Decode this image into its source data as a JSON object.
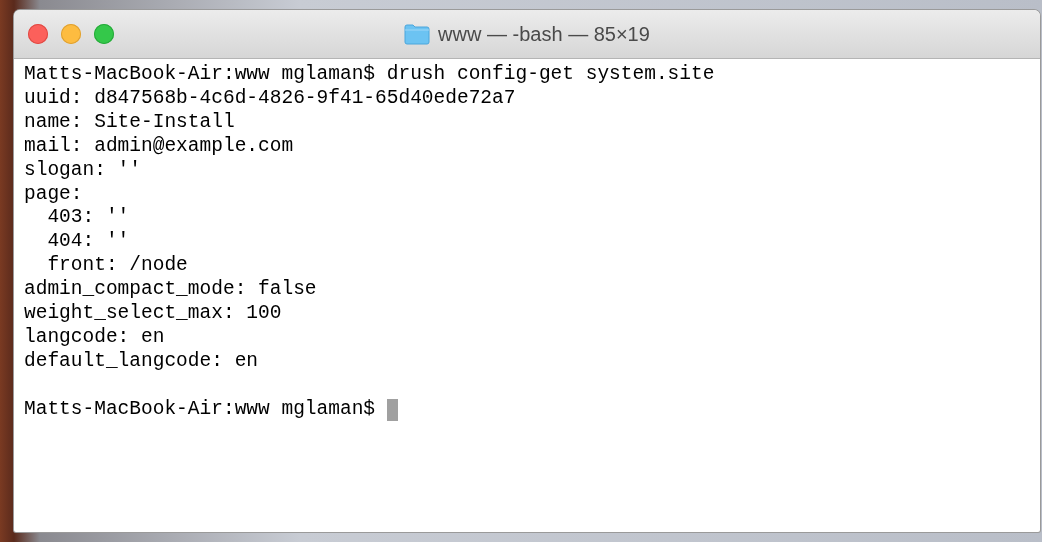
{
  "window": {
    "title": "www — -bash — 85×19"
  },
  "terminal": {
    "lines": [
      "Matts-MacBook-Air:www mglaman$ drush config-get system.site",
      "uuid: d847568b-4c6d-4826-9f41-65d40ede72a7",
      "name: Site-Install",
      "mail: admin@example.com",
      "slogan: ''",
      "page:",
      "  403: ''",
      "  404: ''",
      "  front: /node",
      "admin_compact_mode: false",
      "weight_select_max: 100",
      "langcode: en",
      "default_langcode: en"
    ],
    "prompt": "Matts-MacBook-Air:www mglaman$"
  }
}
